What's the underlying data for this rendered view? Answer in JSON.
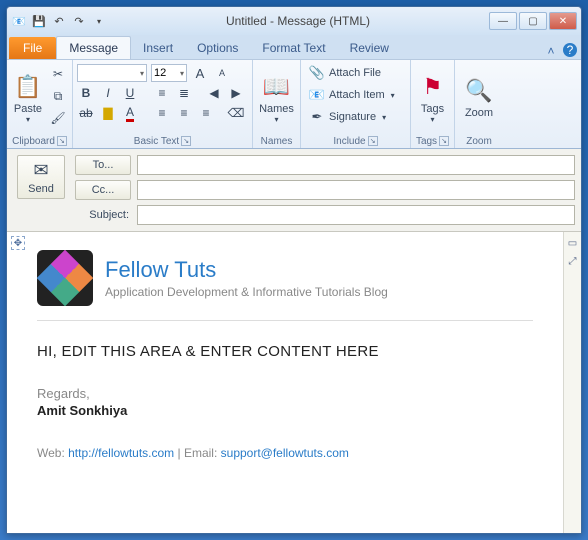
{
  "titlebar": {
    "title": "Untitled  -  Message (HTML)"
  },
  "tabs": {
    "file": "File",
    "items": [
      "Message",
      "Insert",
      "Options",
      "Format Text",
      "Review"
    ],
    "active": 0
  },
  "ribbon": {
    "clipboard": {
      "paste": "Paste",
      "label": "Clipboard"
    },
    "basictext": {
      "label": "Basic Text",
      "fontsize": "12"
    },
    "names": {
      "btn": "Names",
      "label": "Names"
    },
    "include": {
      "label": "Include",
      "attach_file": "Attach File",
      "attach_item": "Attach Item",
      "signature": "Signature"
    },
    "tags": {
      "btn": "Tags",
      "label": "Tags"
    },
    "zoom": {
      "btn": "Zoom",
      "label": "Zoom"
    }
  },
  "header": {
    "send": "Send",
    "to": "To...",
    "cc": "Cc...",
    "subject": "Subject:",
    "to_val": "",
    "cc_val": "",
    "subject_val": ""
  },
  "sig": {
    "title": "Fellow Tuts",
    "subtitle": "Application Development & Informative Tutorials Blog",
    "body": "HI, EDIT THIS AREA & ENTER CONTENT HERE",
    "regards": "Regards,",
    "name": "Amit Sonkhiya",
    "web_label": "Web: ",
    "web_url": "http://fellowtuts.com",
    "sep": " | Email: ",
    "email": "support@fellowtuts.com"
  }
}
